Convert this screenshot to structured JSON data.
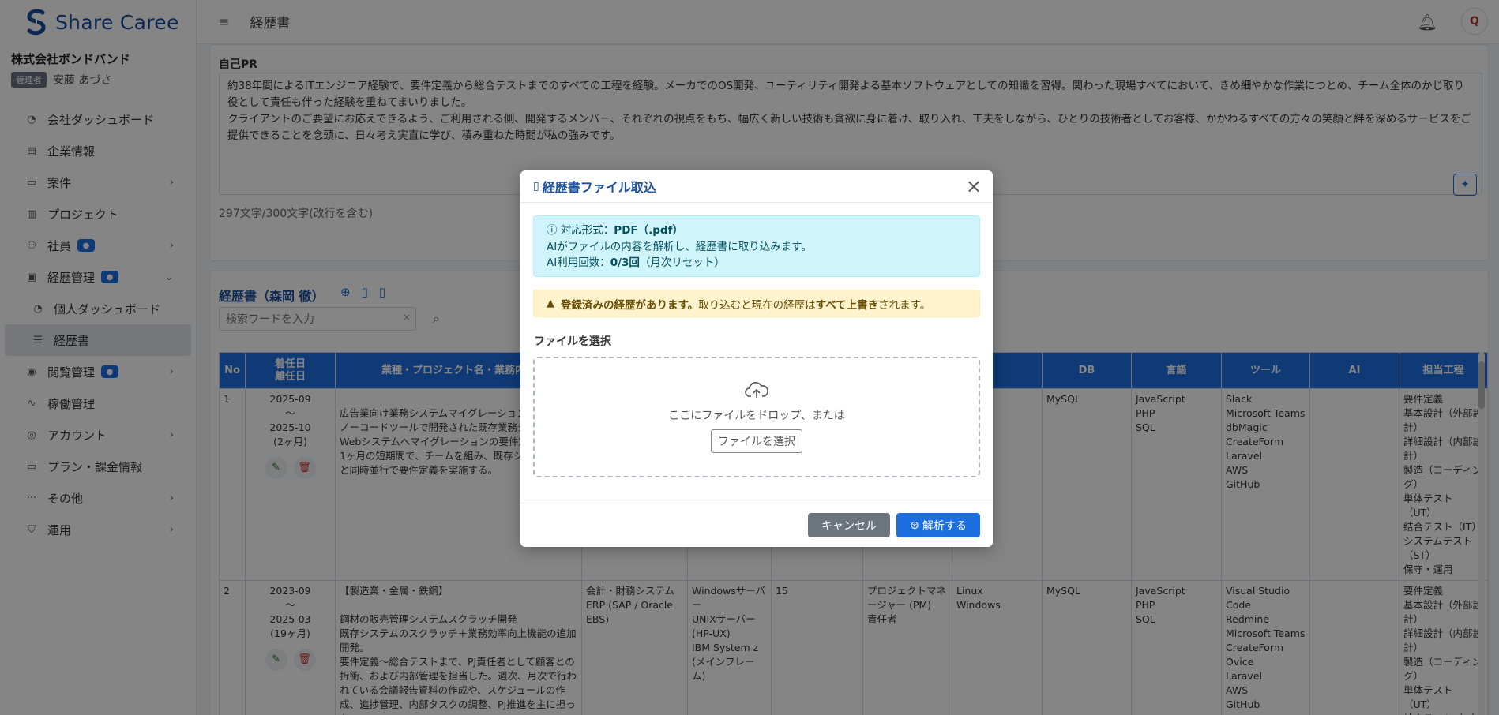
{
  "app": {
    "brand": "Share Caree"
  },
  "company": {
    "name": "株式会社ボンドバンド",
    "role_badge": "管理者",
    "user_name": "安藤 あづさ"
  },
  "topbar": {
    "page_title": "経歴書",
    "avatar_text": "Q"
  },
  "sidebar": {
    "items": [
      {
        "label": "会社ダッシュボード",
        "icon": "dashboard-icon"
      },
      {
        "label": "企業情報",
        "icon": "building-icon"
      },
      {
        "label": "案件",
        "icon": "briefcase-icon"
      },
      {
        "label": "プロジェクト",
        "icon": "kanban-icon"
      },
      {
        "label": "社員",
        "icon": "people-icon"
      },
      {
        "label": "経歴管理",
        "icon": "badge-icon"
      },
      {
        "label": "個人ダッシュボード",
        "icon": "dashboard-icon"
      },
      {
        "label": "経歴書",
        "icon": "list-icon"
      },
      {
        "label": "閲覧管理",
        "icon": "eye-icon"
      },
      {
        "label": "稼働管理",
        "icon": "activity-icon"
      },
      {
        "label": "アカウント",
        "icon": "person-circle-icon"
      },
      {
        "label": "プラン・課金情報",
        "icon": "card-icon"
      },
      {
        "label": "その他",
        "icon": "ellipsis-icon"
      },
      {
        "label": "運用",
        "icon": "shield-icon"
      }
    ]
  },
  "pr": {
    "title": "自己PR",
    "text_line1": "約38年間によるITエンジニア経験で、要件定義から総合テストまでのすべての工程を経験。メーカでのOS開発、ユーティリティ開発よる基本ソフトウェアとしての知識を習得。関わった現場すべてにおいて、きめ細やかな作業につとめ、チーム全体のかじ取り役として責任も伴った経験を重ねてまいりました。",
    "text_line2": "クライアントのご要望にお応えできるよう、ご利用される側、開発するメンバー、それぞれの視点をもち、幅広く新しい技術も貪欲に身に着け、取り入れ、工夫をしながら、ひとりの技術者としてお客様、かかわるすべての方々の笑顔と絆を深めるサービスをご提供できることを念頭に、日々考え実直に学び、積み重ねた時間が私の強みです。",
    "count": "297文字/300文字(改行を含む)"
  },
  "list": {
    "title": "経歴書（森岡 徹）",
    "search_placeholder": "検索ワードを入力",
    "headers": {
      "no": "No",
      "dates_1": "着任日",
      "dates_2": "離任日",
      "project": "業種・プロジェクト名・業務内容",
      "db": "DB",
      "lang": "言語",
      "tool": "ツール",
      "ai": "AI",
      "process": "担当工程"
    },
    "rows": [
      {
        "no": "1",
        "start": "2025-09",
        "tilde": "〜",
        "end": "2025-10",
        "months": "(2ヶ月)",
        "description": "広告業向け業務システムマイグレーション開発\nノーコードツールで開発された既存業務システムを\nWebシステムへマイグレーションの要件定義\n1ヶ月の短期間で、チームを組み、既存システム\nと同時並行で要件定義を実施する。",
        "system": "",
        "server": "",
        "team": "",
        "role": "",
        "os": "",
        "db": "MySQL",
        "lang": "JavaScript\nPHP\nSQL",
        "tool": "Slack\nMicrosoft Teams\ndbMagic\nCreateForm\nLaravel\nAWS\nGitHub",
        "ai": "",
        "process": "要件定義\n基本設計（外部設計）\n詳細設計（内部設計）\n製造（コーディング）\n単体テスト（UT）\n結合テスト（IT）\nシステムテスト（ST）\n保守・運用"
      },
      {
        "no": "2",
        "start": "2023-09",
        "tilde": "〜",
        "end": "2025-03",
        "months": "(19ヶ月)",
        "description": "【製造業・金属・鉄鋼】\n\n鋼材の販売管理システムスクラッチ開発\n既存システムのスクラッチ＋業務効率向上機能の追加開発。\n要件定義〜総合テストまで、PJ責任者として顧客との折衝、および内部管理を担当した。週次、月次で行われている会議報告資料の作成や、スケジュールの作成、進捗管理、内部タスクの調整、PJ推進を主に担った。",
        "system": "会計・財務システム\nERP (SAP / Oracle EBS)",
        "server": "Windowsサーバー\nUNIXサーバー (HP-UX)\nIBM System z (メインフレーム)",
        "team": "15",
        "role": "プロジェクトマネージャー (PM)\n責任者",
        "os": "Linux\nWindows",
        "db": "MySQL",
        "lang": "JavaScript\nPHP\nSQL",
        "tool": "Visual Studio Code\nRedmine\nMicrosoft Teams\nCreateForm\nOvice\nLaravel\nAWS\nGitHub",
        "ai": "",
        "process": "要件定義\n基本設計（外部設計）\n詳細設計（内部設計）\n製造（コーディング）\n単体テスト（UT）\n結合テスト（IT）\nシステムテスト"
      }
    ]
  },
  "modal": {
    "title": "経歴書ファイル取込",
    "info_format_label": "対応形式：",
    "info_format_value": "PDF（.pdf）",
    "info_line2": "AIがファイルの内容を解析し、経歴書に取り込みます。",
    "info_usage_label": "AI利用回数：",
    "info_usage_value": "0/3回",
    "info_usage_note": "（月次リセット）",
    "warn_bold1": "登録済みの経歴があります。",
    "warn_text1": "取り込むと現在の経歴は",
    "warn_bold2": "すべて上書き",
    "warn_text2": "されます。",
    "file_label": "ファイルを選択",
    "drop_text": "ここにファイルをドロップ、または",
    "pick_button": "ファイルを選択",
    "cancel_button": "キャンセル",
    "analyze_button": "解析する"
  },
  "colors": {
    "primary": "#1d6fe0",
    "brand": "#1b4f9c",
    "info_bg": "#cff4fc",
    "warn_bg": "#fff3cd",
    "cancel": "#6c757d"
  }
}
